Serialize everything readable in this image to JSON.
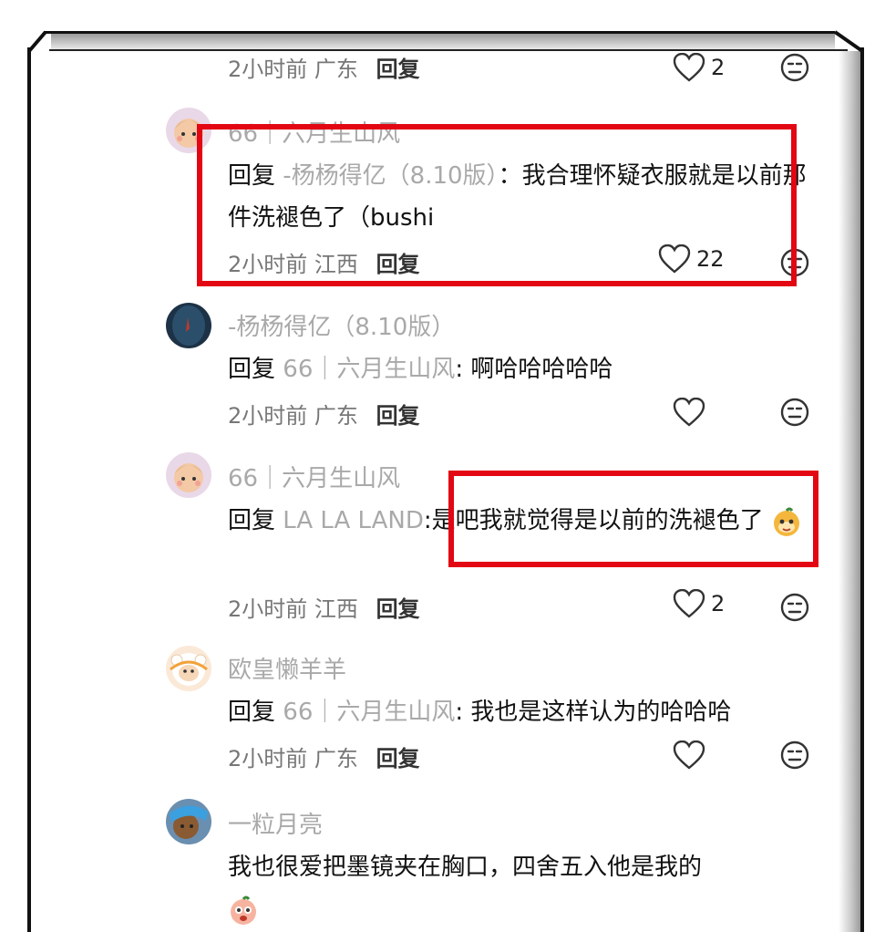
{
  "comments": [
    {
      "id": "c0",
      "meta": {
        "time": "2小时前",
        "location": "广东",
        "reply_label": "回复"
      },
      "likes": "2"
    },
    {
      "id": "c1",
      "name": "66｜六月生山风",
      "reply_prefix": "回复",
      "reply_target": "-杨杨得亿（8.10版）",
      "text": "：我合理怀疑衣服就是以前那件洗褪色了（bushi",
      "meta": {
        "time": "2小时前",
        "location": "江西",
        "reply_label": "回复"
      },
      "likes": "22"
    },
    {
      "id": "c2",
      "name": "-杨杨得亿（8.10版）",
      "reply_prefix": "回复",
      "reply_target": "66｜六月生山风",
      "text": ": 啊哈哈哈哈哈",
      "meta": {
        "time": "2小时前",
        "location": "广东",
        "reply_label": "回复"
      },
      "likes": ""
    },
    {
      "id": "c3",
      "name": "66｜六月生山风",
      "reply_prefix": "回复",
      "reply_target": "LA LA LAND",
      "text": ":是吧我就觉得是以前的洗褪色了",
      "meta": {
        "time": "2小时前",
        "location": "江西",
        "reply_label": "回复"
      },
      "likes": "2"
    },
    {
      "id": "c4",
      "name": "欧皇懒羊羊",
      "reply_prefix": "回复",
      "reply_target": "66｜六月生山风",
      "text": ": 我也是这样认为的哈哈哈",
      "meta": {
        "time": "2小时前",
        "location": "广东",
        "reply_label": "回复"
      },
      "likes": ""
    },
    {
      "id": "c5",
      "name": "一粒月亮",
      "text": "我也很爱把墨镜夹在胸口，四舍五入他是我的"
    }
  ],
  "colors": {
    "highlight": "#e30613",
    "muted": "#a9a9a9"
  },
  "icons": [
    "heart-icon",
    "dislike-face-icon",
    "emoji-sticker"
  ]
}
